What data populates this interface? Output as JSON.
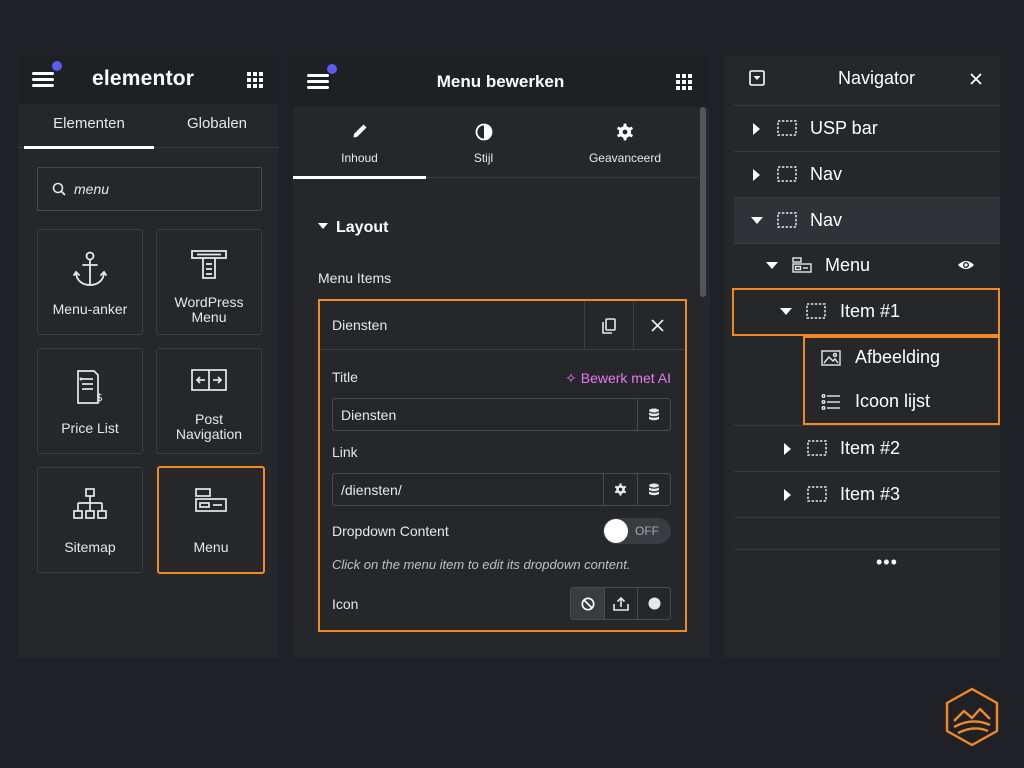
{
  "colors": {
    "accent": "#f08a24",
    "notification_dot": "#5b5bf2",
    "ai_link": "#e879f2",
    "panel_bg": "#26272b",
    "page_bg": "#202126"
  },
  "left_panel": {
    "logo": "elementor",
    "menu_icon": "hamburger-icon",
    "apps_icon": "grid-icon",
    "tabs": [
      {
        "label": "Elementen",
        "active": true
      },
      {
        "label": "Globalen",
        "active": false
      }
    ],
    "search": {
      "value": "menu",
      "icon": "search-icon"
    },
    "widgets": [
      {
        "label": "Menu-anker",
        "icon": "anchor-icon",
        "highlighted": false
      },
      {
        "label": "WordPress Menu",
        "icon": "wordpress-menu-icon",
        "highlighted": false
      },
      {
        "label": "Price List",
        "icon": "price-list-icon",
        "highlighted": false
      },
      {
        "label": "Post Navigation",
        "icon": "post-navigation-icon",
        "highlighted": false
      },
      {
        "label": "Sitemap",
        "icon": "sitemap-icon",
        "highlighted": false
      },
      {
        "label": "Menu",
        "icon": "menu-widget-icon",
        "highlighted": true
      }
    ]
  },
  "middle_panel": {
    "title": "Menu bewerken",
    "tabs": [
      {
        "label": "Inhoud",
        "icon": "pencil-icon",
        "active": true
      },
      {
        "label": "Stijl",
        "icon": "contrast-icon",
        "active": false
      },
      {
        "label": "Geavanceerd",
        "icon": "gear-icon",
        "active": false
      }
    ],
    "section_title": "Layout",
    "menu_items_label": "Menu Items",
    "item": {
      "title": "Diensten",
      "title_label": "Title",
      "ai_label": "Bewerk met AI",
      "title_value": "Diensten",
      "link_label": "Link",
      "link_value": "/diensten/",
      "dropdown_label": "Dropdown Content",
      "dropdown_state": "OFF",
      "dropdown_hint": "Click on the menu item to edit its dropdown content.",
      "icon_label": "Icon"
    }
  },
  "navigator": {
    "title": "Navigator",
    "rows": [
      {
        "label": "USP bar",
        "expanded": false,
        "icon": "container-icon"
      },
      {
        "label": "Nav",
        "expanded": false,
        "icon": "container-icon"
      },
      {
        "label": "Nav",
        "expanded": true,
        "icon": "container-icon"
      },
      {
        "label": "Menu",
        "expanded": true,
        "icon": "menu-widget-icon"
      },
      {
        "label": "Item #1",
        "expanded": true,
        "icon": "container-icon"
      },
      {
        "label": "Afbeelding",
        "icon": "image-icon"
      },
      {
        "label": "Icoon lijst",
        "icon": "icon-list-icon"
      },
      {
        "label": "Item #2",
        "expanded": false,
        "icon": "container-icon"
      },
      {
        "label": "Item #3",
        "expanded": false,
        "icon": "container-icon"
      }
    ],
    "more": "•••"
  }
}
